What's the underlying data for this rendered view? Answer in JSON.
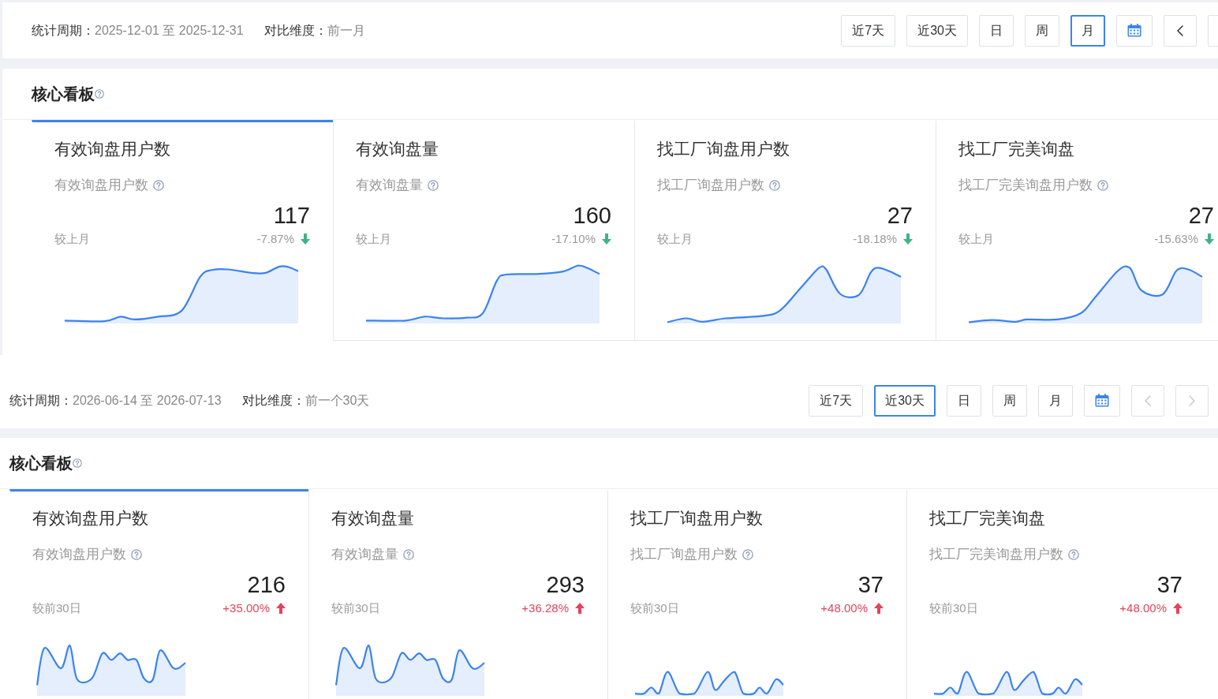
{
  "dashboards": [
    {
      "filter_bar": {
        "period_label": "统计周期：",
        "period": "2025-12-01 至 2025-12-31",
        "compare_label": "对比维度：",
        "compare": "前一月",
        "buttons": [
          {
            "kind": "text",
            "label": "近7天",
            "selected": false
          },
          {
            "kind": "text",
            "label": "近30天",
            "selected": false
          },
          {
            "kind": "text",
            "label": "日",
            "selected": false
          },
          {
            "kind": "text",
            "label": "周",
            "selected": false
          },
          {
            "kind": "text",
            "label": "月",
            "selected": true
          },
          {
            "kind": "calendar",
            "selected": false
          },
          {
            "kind": "prev",
            "selected": false,
            "disabled": false
          },
          {
            "kind": "clipped",
            "selected": false
          }
        ]
      },
      "panel": {
        "title": "核心看板",
        "cards": [
          {
            "title": "有效询盘用户数",
            "subtitle": "有效询盘用户数",
            "value": "117",
            "compare_label": "较上月",
            "change": "-7.87%",
            "increase": false,
            "selected": true
          },
          {
            "title": "有效询盘量",
            "subtitle": "有效询盘量",
            "value": "160",
            "compare_label": "较上月",
            "change": "-17.10%",
            "increase": false,
            "selected": false
          },
          {
            "title": "找工厂询盘用户数",
            "subtitle": "找工厂询盘用户数",
            "value": "27",
            "compare_label": "较上月",
            "change": "-18.18%",
            "increase": false,
            "selected": false
          },
          {
            "title": "找工厂完美询盘",
            "subtitle": "找工厂完美询盘用户数",
            "value": "27",
            "compare_label": "较上月",
            "change": "-15.63%",
            "increase": false,
            "selected": false
          }
        ]
      }
    },
    {
      "filter_bar": {
        "period_label": "统计周期：",
        "period": "2026-06-14 至 2026-07-13",
        "compare_label": "对比维度：",
        "compare": "前一个30天",
        "buttons": [
          {
            "kind": "text",
            "label": "近7天",
            "selected": false
          },
          {
            "kind": "text",
            "label": "近30天",
            "selected": true
          },
          {
            "kind": "text",
            "label": "日",
            "selected": false
          },
          {
            "kind": "text",
            "label": "周",
            "selected": false
          },
          {
            "kind": "text",
            "label": "月",
            "selected": false
          },
          {
            "kind": "calendar",
            "selected": false
          },
          {
            "kind": "prev",
            "selected": false,
            "disabled": true
          },
          {
            "kind": "next",
            "selected": false,
            "disabled": true
          }
        ]
      },
      "panel": {
        "title": "核心看板",
        "cards": [
          {
            "title": "有效询盘用户数",
            "subtitle": "有效询盘用户数",
            "value": "216",
            "compare_label": "较前30日",
            "change": "+35.00%",
            "increase": true,
            "selected": true
          },
          {
            "title": "有效询盘量",
            "subtitle": "有效询盘量",
            "value": "293",
            "compare_label": "较前30日",
            "change": "+36.28%",
            "increase": true,
            "selected": false
          },
          {
            "title": "找工厂询盘用户数",
            "subtitle": "找工厂询盘用户数",
            "value": "37",
            "compare_label": "较前30日",
            "change": "+48.00%",
            "increase": true,
            "selected": false
          },
          {
            "title": "找工厂完美询盘",
            "subtitle": "找工厂完美询盘用户数",
            "value": "37",
            "compare_label": "较前30日",
            "change": "+48.00%",
            "increase": true,
            "selected": false
          }
        ]
      }
    }
  ]
}
